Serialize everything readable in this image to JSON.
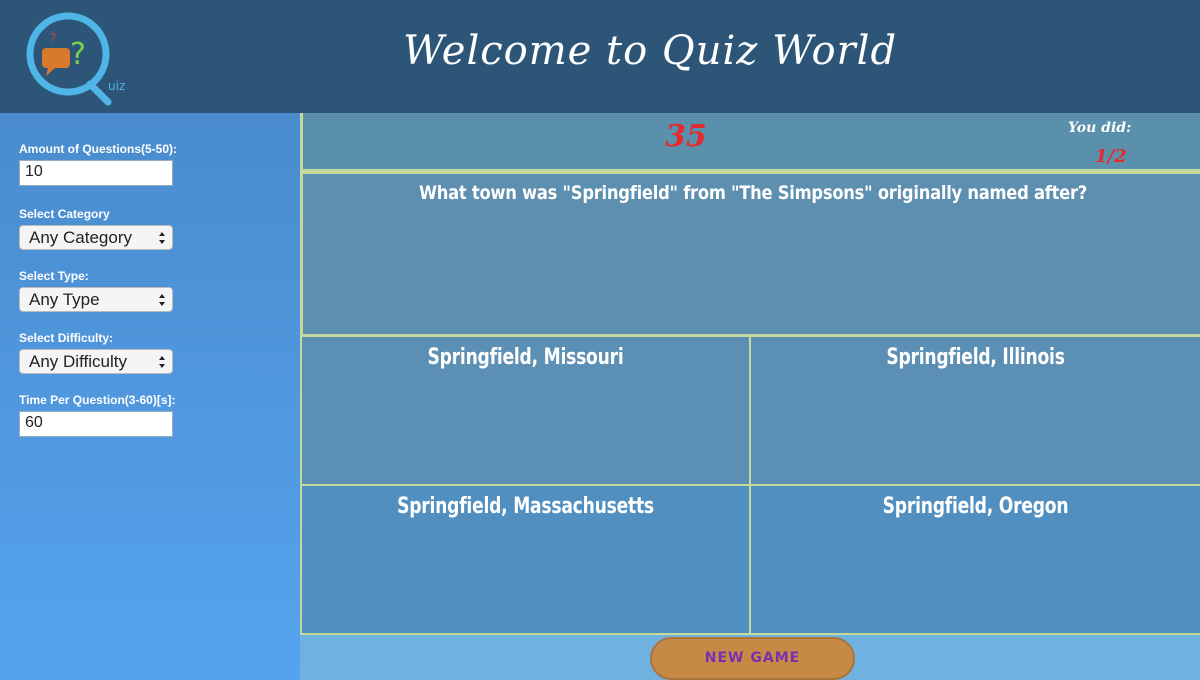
{
  "header": {
    "title": "Welcome to  Quiz World",
    "logo_text": "uiz",
    "logo_question_marks": [
      "?",
      "?"
    ]
  },
  "sidebar": {
    "amount": {
      "label": "Amount of Questions(5-50):",
      "value": "10"
    },
    "category": {
      "label": "Select Category",
      "value": "Any Category"
    },
    "type": {
      "label": "Select Type:",
      "value": "Any Type"
    },
    "difficulty": {
      "label": "Select Difficulty:",
      "value": "Any Difficulty"
    },
    "time": {
      "label": "Time Per Question(3-60)[s]:",
      "value": "60"
    }
  },
  "game": {
    "timer": "35",
    "score_label": "You did:",
    "score_value": "1/2",
    "question": "What town was \"Springfield\" from \"The Simpsons\" originally named after?",
    "answers": [
      "Springfield, Missouri",
      "Springfield, Illinois",
      "Springfield, Massachusetts",
      "Springfield, Oregon"
    ],
    "new_game_label": "NEW GAME"
  },
  "colors": {
    "header_bg": "#2c5578",
    "timer_red": "#e32b2b",
    "divider": "#c5d99a",
    "button_orange": "#c78a46",
    "button_text_purple": "#7a2fb0"
  }
}
